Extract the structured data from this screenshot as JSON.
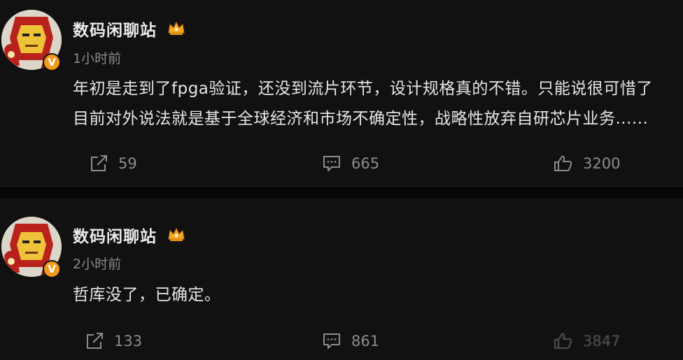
{
  "posts": [
    {
      "author": "数码闲聊站",
      "time": "1小时前",
      "content_lines": [
        "年初是走到了fpga验证，还没到流片环节，设计规格真的不错。只能说很可惜了",
        "目前对外说法就是基于全球经济和市场不确定性，战略性放弃自研芯片业务......"
      ],
      "shares": "59",
      "comments": "665",
      "likes": "3200",
      "verified_badge": "V",
      "icons": {
        "verified": "crown-badge-icon",
        "share": "share-icon",
        "comment": "comment-icon",
        "like": "thumbs-up-icon"
      }
    },
    {
      "author": "数码闲聊站",
      "time": "2小时前",
      "content_lines": [
        "哲库没了，已确定。"
      ],
      "shares": "133",
      "comments": "861",
      "likes": "3847",
      "verified_badge": "V",
      "icons": {
        "verified": "crown-badge-icon",
        "share": "share-icon",
        "comment": "comment-icon",
        "like": "thumbs-up-icon"
      }
    }
  ],
  "colors": {
    "background": "#111111",
    "text": "#e6e6e6",
    "muted": "#8a8a8a",
    "badge": "#f39a1a",
    "crown": "#f5a623"
  }
}
